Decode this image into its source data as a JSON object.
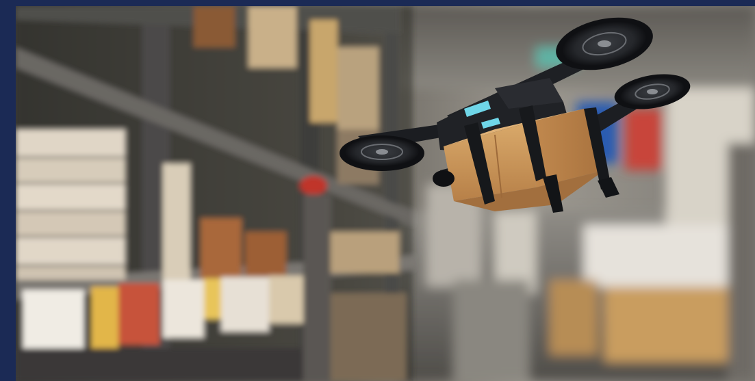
{
  "image": {
    "subject": "delivery-drone-in-warehouse",
    "colors": {
      "frame": "#1b2a55",
      "box": "#c9955a",
      "drone_body": "#1a1c20",
      "drone_light": "#6fd6e8"
    }
  }
}
